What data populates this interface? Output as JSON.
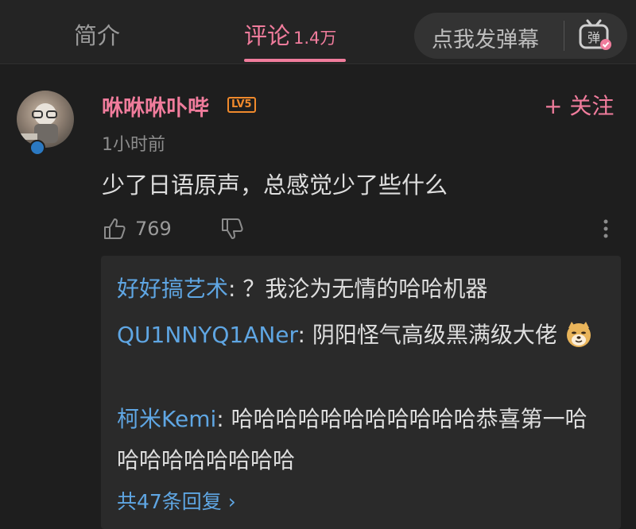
{
  "tabs": {
    "intro": "简介",
    "comments": "评论",
    "comments_count": "1.4万"
  },
  "danmaku": {
    "placeholder": "点我发弹幕",
    "icon": "danmaku-toggle-icon"
  },
  "comment": {
    "username": "咻咻咻卟哔",
    "level": "LV5",
    "follow_label": "+ 关注",
    "time": "1小时前",
    "text": "少了日语原声，总感觉少了些什么",
    "likes": "769"
  },
  "replies": [
    {
      "name": "好好搞艺术",
      "sep": ": ",
      "text": "？我沦为无情的哈哈机器"
    },
    {
      "name": "QU1NNYQ1ANer",
      "sep": ": ",
      "text": "阴阳怪气高级黑满级大佬"
    },
    {
      "name": "柯米Kemi",
      "sep": ": ",
      "text": "哈哈哈哈哈哈哈哈哈哈哈恭喜第一哈哈哈哈哈哈哈哈哈"
    }
  ],
  "more_replies": "共47条回复 ›",
  "colors": {
    "accent": "#f07c9c",
    "reply_name": "#5fa6e3",
    "level": "#f08a2c"
  }
}
